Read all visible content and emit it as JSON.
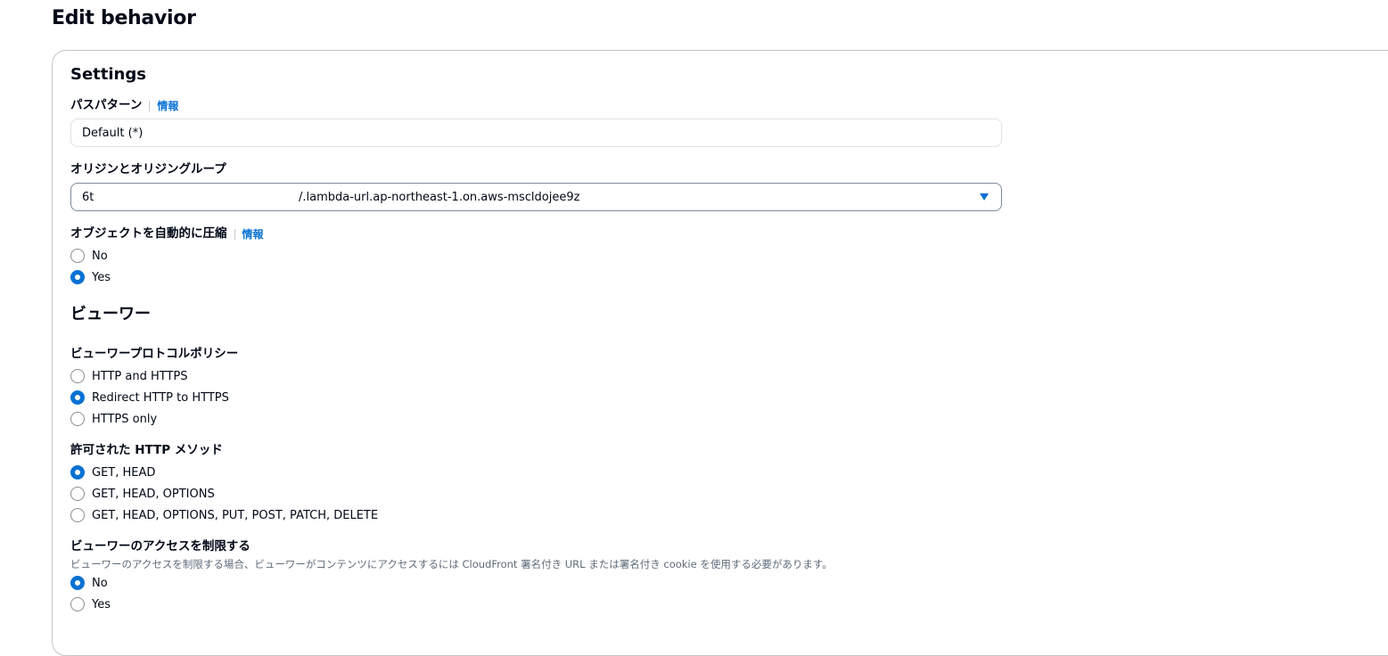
{
  "page": {
    "title": "Edit behavior"
  },
  "settings": {
    "title": "Settings",
    "path_pattern": {
      "label": "パスパターン",
      "info": "情報",
      "value": "Default (*)"
    },
    "origin": {
      "label": "オリジンとオリジングループ",
      "value_prefix": "6t",
      "value": "/.lambda-url.ap-northeast-1.on.aws-mscldojee9z"
    },
    "compress": {
      "label": "オブジェクトを自動的に圧縮",
      "info": "情報",
      "options": [
        {
          "label": "No",
          "selected": false
        },
        {
          "label": "Yes",
          "selected": true
        }
      ]
    }
  },
  "viewer": {
    "title": "ビューワー",
    "protocol_policy": {
      "label": "ビューワープロトコルポリシー",
      "options": [
        {
          "label": "HTTP and HTTPS",
          "selected": false
        },
        {
          "label": "Redirect HTTP to HTTPS",
          "selected": true
        },
        {
          "label": "HTTPS only",
          "selected": false
        }
      ]
    },
    "allowed_methods": {
      "label": "許可された HTTP メソッド",
      "options": [
        {
          "label": "GET, HEAD",
          "selected": true
        },
        {
          "label": "GET, HEAD, OPTIONS",
          "selected": false
        },
        {
          "label": "GET, HEAD, OPTIONS, PUT, POST, PATCH, DELETE",
          "selected": false
        }
      ]
    },
    "restrict_access": {
      "label": "ビューワーのアクセスを制限する",
      "description": "ビューワーのアクセスを制限する場合、ビューワーがコンテンツにアクセスするには CloudFront 署名付き URL または署名付き cookie を使用する必要があります。",
      "options": [
        {
          "label": "No",
          "selected": true
        },
        {
          "label": "Yes",
          "selected": false
        }
      ]
    }
  },
  "colors": {
    "accent": "#0972d3",
    "text": "#000716",
    "border": "#c6c6cd"
  }
}
